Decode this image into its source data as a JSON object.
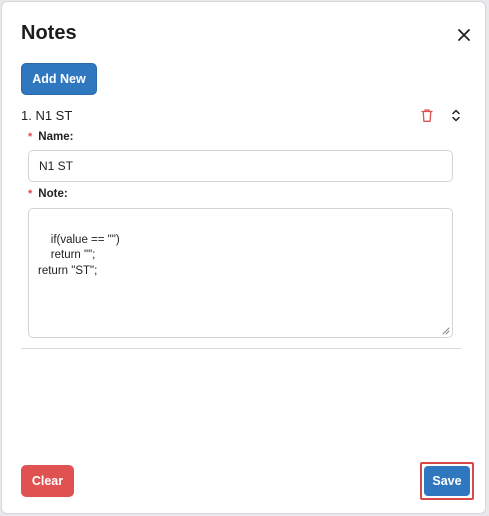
{
  "dialog": {
    "title": "Notes",
    "close_icon": "close-icon"
  },
  "toolbar": {
    "add_new_label": "Add New"
  },
  "notes": [
    {
      "title": "1. N1 ST",
      "name_label": "Name:",
      "name_value": "N1 ST",
      "note_label": "Note:",
      "note_value": "if(value == \"\")\n    return \"\";\nreturn \"ST\";",
      "icons": {
        "delete": "trash-icon",
        "expand": "chevron-up-down-icon"
      }
    }
  ],
  "footer": {
    "clear_label": "Clear",
    "save_label": "Save"
  },
  "colors": {
    "primary": "#2f78bf",
    "danger": "#e05252",
    "required": "#e0474c",
    "highlight_outline": "#d94848"
  }
}
